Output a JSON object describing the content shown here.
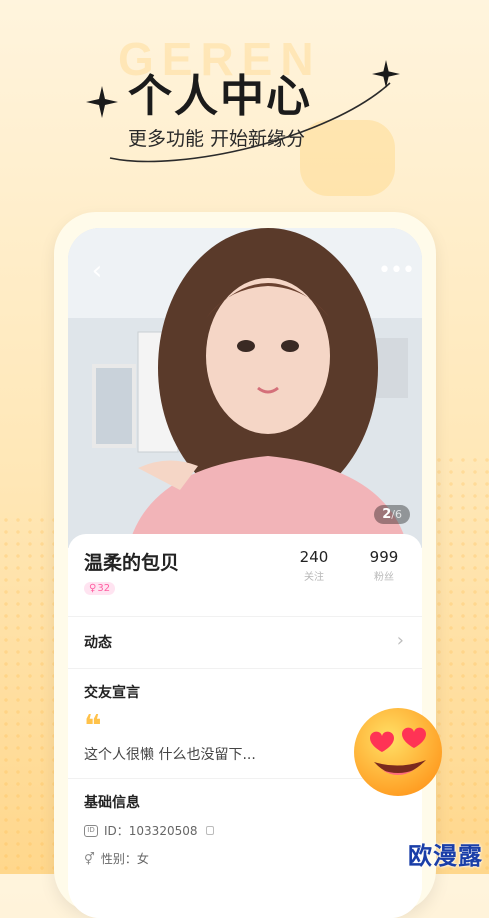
{
  "hero": {
    "bg_word": "GEREN",
    "title": "个人中心",
    "subtitle": "更多功能 开始新缘分"
  },
  "profile": {
    "photo_counter_current": "2",
    "photo_counter_total": "6",
    "nickname": "温柔的包贝",
    "age": "32",
    "gender_icon": "female-icon",
    "stats": {
      "follow_count": "240",
      "follow_label": "关注",
      "fans_count": "999",
      "fans_label": "粉丝"
    },
    "dynamic_label": "动态",
    "declaration_label": "交友宣言",
    "declaration_text": "这个人很懒 什么也没留下...",
    "basic_info_label": "基础信息",
    "id_text": "ID：103320508",
    "gender_text": "性别：女"
  },
  "watermark": "欧漫露",
  "colors": {
    "accent": "#ffc24a",
    "badge_pink": "#ff5fa2",
    "background_top": "#fff4dd",
    "background_bottom": "#ffd78c"
  }
}
